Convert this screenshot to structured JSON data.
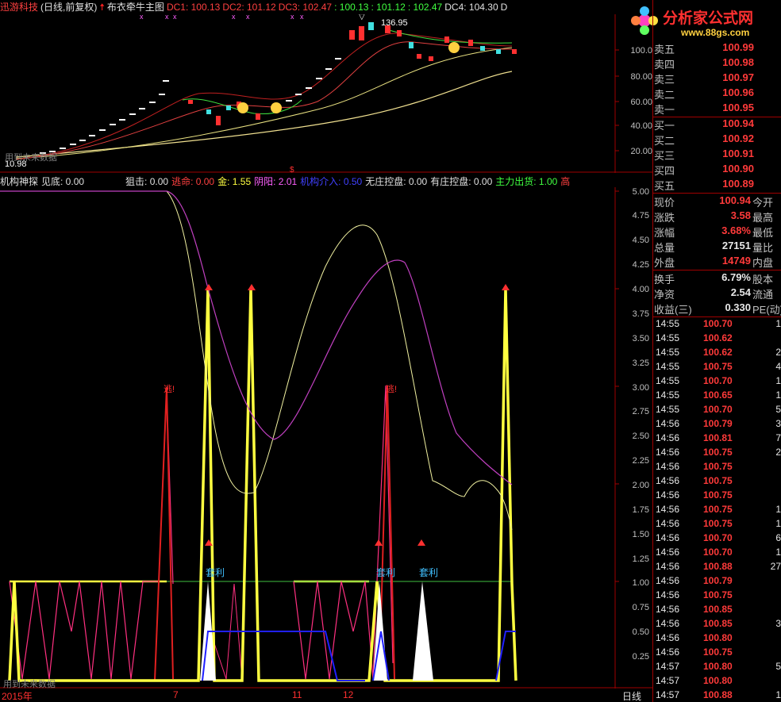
{
  "title_bar": {
    "app": "迅游科技",
    "mode": "(日线,前复权)",
    "indicator": "布衣牵牛主图",
    "dc1": "DC1: 100.13",
    "dc2": "DC2: 101.12",
    "dc3": "DC3: 102.47",
    "v1": ": 100.13",
    "v2": ": 101.12",
    "v3": ": 102.47",
    "dc4": "DC4: 104.30",
    "dc5": "D"
  },
  "logo": {
    "text": "分析家公式网",
    "url": "www.88gs.com"
  },
  "price_axis": [
    "100.0",
    "80.00",
    "60.00",
    "40.00",
    "20.00"
  ],
  "price_annotations": {
    "high": "136.95",
    "low": "10.98",
    "note": "用到未来数据"
  },
  "indicator_bar": {
    "name": "机构神探",
    "jiandi": "见底: 0.00",
    "juji": "狙击: 0.00",
    "taoming": "逃命: 0.00",
    "jin": "金: 1.55",
    "yinyang": "阴阳: 2.01",
    "jigou": "机构介入: 0.50",
    "wuzhuang": "无庄控盘: 0.00",
    "youzhuang": "有庄控盘: 0.00",
    "zhuli": "主力出货: 1.00",
    "gao": "高"
  },
  "lower_axis": [
    "5.00",
    "4.75",
    "4.50",
    "4.25",
    "4.00",
    "3.75",
    "3.50",
    "3.25",
    "3.00",
    "2.75",
    "2.50",
    "2.25",
    "2.00",
    "1.75",
    "1.50",
    "1.25",
    "1.00",
    "0.75",
    "0.50",
    "0.25"
  ],
  "lower_annotations": {
    "tao1": "逃!",
    "tao2": "逃!",
    "tl1": "套利",
    "tl2": "套利",
    "tl3": "套利",
    "note": "用到未来数据"
  },
  "time_axis": {
    "year": "2015年",
    "m7": "7",
    "m11": "11",
    "m12": "12",
    "period": "日线"
  },
  "order_book": {
    "asks": [
      {
        "label": "卖五",
        "price": "100.99"
      },
      {
        "label": "卖四",
        "price": "100.98"
      },
      {
        "label": "卖三",
        "price": "100.97"
      },
      {
        "label": "卖二",
        "price": "100.96"
      },
      {
        "label": "卖一",
        "price": "100.95"
      }
    ],
    "bids": [
      {
        "label": "买一",
        "price": "100.94"
      },
      {
        "label": "买二",
        "price": "100.92"
      },
      {
        "label": "买三",
        "price": "100.91"
      },
      {
        "label": "买四",
        "price": "100.90"
      },
      {
        "label": "买五",
        "price": "100.89"
      }
    ]
  },
  "stats": [
    {
      "label": "现价",
      "value": "100.94",
      "right": "今开"
    },
    {
      "label": "涨跌",
      "value": "3.58",
      "right": "最高"
    },
    {
      "label": "涨幅",
      "value": "3.68%",
      "right": "最低"
    },
    {
      "label": "总量",
      "value": "27151",
      "right": "量比",
      "white": true
    },
    {
      "label": "外盘",
      "value": "14749",
      "right": "内盘"
    }
  ],
  "stats2": [
    {
      "label": "换手",
      "value": "6.79%",
      "right": "股本"
    },
    {
      "label": "净资",
      "value": "2.54",
      "right": "流通"
    },
    {
      "label": "收益(三)",
      "value": "0.330",
      "right": "PE(动)"
    }
  ],
  "ticks": [
    {
      "time": "14:55",
      "price": "100.70",
      "qty": "1",
      "dir": "up"
    },
    {
      "time": "14:55",
      "price": "100.62",
      "qty": "",
      "dir": "up"
    },
    {
      "time": "14:55",
      "price": "100.62",
      "qty": "2",
      "dir": "up"
    },
    {
      "time": "14:55",
      "price": "100.75",
      "qty": "4",
      "dir": "up"
    },
    {
      "time": "14:55",
      "price": "100.70",
      "qty": "1",
      "dir": "up"
    },
    {
      "time": "14:55",
      "price": "100.65",
      "qty": "1",
      "dir": "up"
    },
    {
      "time": "14:55",
      "price": "100.70",
      "qty": "5",
      "dir": "up"
    },
    {
      "time": "14:56",
      "price": "100.79",
      "qty": "3",
      "dir": "up"
    },
    {
      "time": "14:56",
      "price": "100.81",
      "qty": "7",
      "dir": "up"
    },
    {
      "time": "14:56",
      "price": "100.75",
      "qty": "2",
      "dir": "up"
    },
    {
      "time": "14:56",
      "price": "100.75",
      "qty": "",
      "dir": "up"
    },
    {
      "time": "14:56",
      "price": "100.75",
      "qty": "",
      "dir": "up"
    },
    {
      "time": "14:56",
      "price": "100.75",
      "qty": "",
      "dir": "up"
    },
    {
      "time": "14:56",
      "price": "100.75",
      "qty": "1",
      "dir": "up"
    },
    {
      "time": "14:56",
      "price": "100.75",
      "qty": "1",
      "dir": "up"
    },
    {
      "time": "14:56",
      "price": "100.70",
      "qty": "6",
      "dir": "up"
    },
    {
      "time": "14:56",
      "price": "100.70",
      "qty": "1",
      "dir": "up"
    },
    {
      "time": "14:56",
      "price": "100.88",
      "qty": "27",
      "dir": "up"
    },
    {
      "time": "14:56",
      "price": "100.79",
      "qty": "",
      "dir": "up"
    },
    {
      "time": "14:56",
      "price": "100.75",
      "qty": "",
      "dir": "up"
    },
    {
      "time": "14:56",
      "price": "100.85",
      "qty": "",
      "dir": "up"
    },
    {
      "time": "14:56",
      "price": "100.85",
      "qty": "3",
      "dir": "up"
    },
    {
      "time": "14:56",
      "price": "100.80",
      "qty": "",
      "dir": "up"
    },
    {
      "time": "14:56",
      "price": "100.75",
      "qty": "",
      "dir": "up"
    },
    {
      "time": "14:57",
      "price": "100.80",
      "qty": "5",
      "dir": "up"
    },
    {
      "time": "14:57",
      "price": "100.80",
      "qty": "",
      "dir": "up"
    },
    {
      "time": "14:57",
      "price": "100.88",
      "qty": "1",
      "dir": "up"
    }
  ],
  "colors": {
    "grid_red": "#a00000",
    "price_red": "#ff3a3a",
    "yellow": "#ffff40",
    "magenta": "#c040c0"
  }
}
